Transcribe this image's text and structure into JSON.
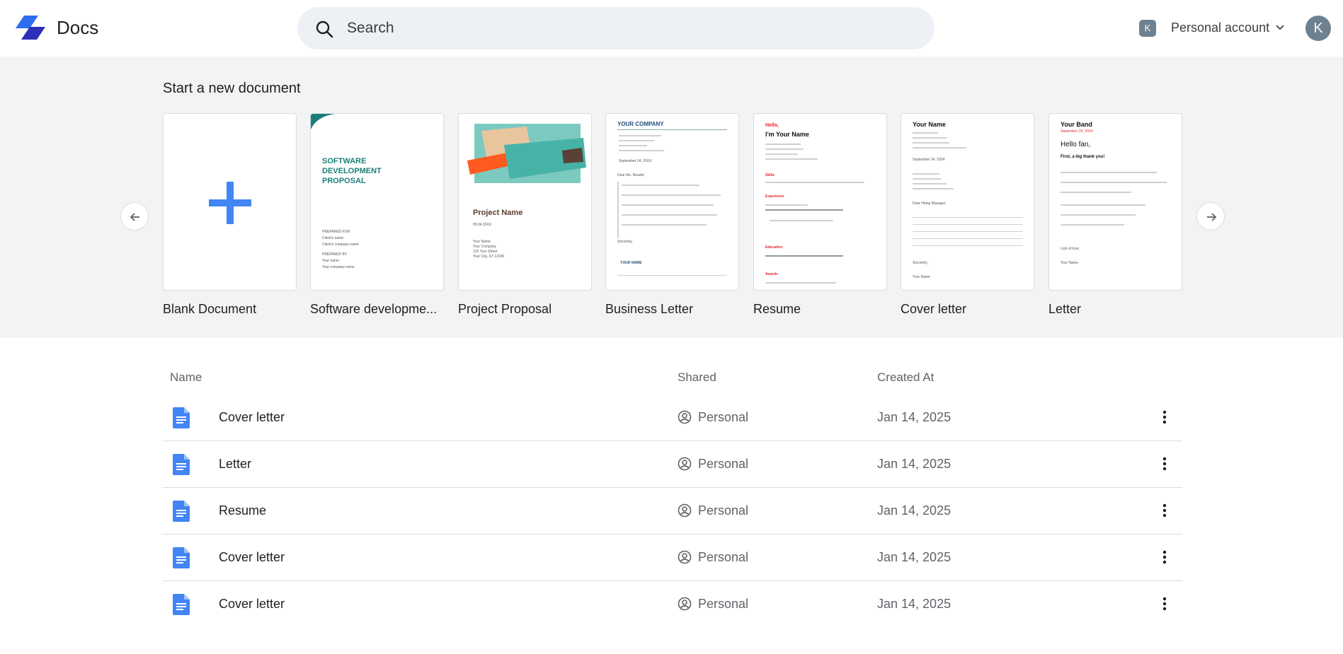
{
  "app": {
    "name": "Docs"
  },
  "search": {
    "placeholder": "Search"
  },
  "account": {
    "badge": "K",
    "label": "Personal account",
    "avatar": "K"
  },
  "templates": {
    "title": "Start a new document",
    "items": [
      {
        "label": "Blank Document"
      },
      {
        "label": "Software developme..."
      },
      {
        "label": "Project Proposal"
      },
      {
        "label": "Business Letter"
      },
      {
        "label": "Resume"
      },
      {
        "label": "Cover letter"
      },
      {
        "label": "Letter"
      }
    ],
    "previews": {
      "software": {
        "title": "SOFTWARE DEVELOPMENT PROPOSAL",
        "prepared_for": "PREPARED FOR",
        "client_name": "Client's name",
        "client_company": "Client's company name",
        "prepared_by": "PREPARED BY",
        "your_name": "Your name",
        "your_company": "Your company name"
      },
      "project": {
        "title": "Project Name",
        "date": "09.04.20XX",
        "lines": "Your Name\nYour Company\n123 Your Street\nYour City, ST 12345"
      },
      "business": {
        "company": "YOUR COMPANY",
        "sign": "YOUR NAME",
        "date": "September 24, 20XX",
        "greeting": "Dear Ms. Reader,",
        "closing": "Sincerely,"
      },
      "resume": {
        "hello": "Hello,",
        "name": "I'm Your Name",
        "skills": "Skills",
        "experience": "Experience",
        "education": "Education",
        "awards": "Awards"
      },
      "cover": {
        "name": "Your Name",
        "date": "September 24, 2024",
        "greeting": "Dear Hiring Manager,",
        "closing": "Sincerely,",
        "sign": "Your Name"
      },
      "letter": {
        "band": "Your Band",
        "date": "September 24, 20XX",
        "greeting": "Hello fan,",
        "lead": "First, a big thank you!",
        "closing": "Lots of love,",
        "sign": "Your Name"
      }
    }
  },
  "table": {
    "headers": {
      "name": "Name",
      "shared": "Shared",
      "created": "Created At"
    },
    "rows": [
      {
        "name": "Cover letter",
        "shared": "Personal",
        "created": "Jan 14, 2025"
      },
      {
        "name": "Letter",
        "shared": "Personal",
        "created": "Jan 14, 2025"
      },
      {
        "name": "Resume",
        "shared": "Personal",
        "created": "Jan 14, 2025"
      },
      {
        "name": "Cover letter",
        "shared": "Personal",
        "created": "Jan 14, 2025"
      },
      {
        "name": "Cover letter",
        "shared": "Personal",
        "created": "Jan 14, 2025"
      }
    ]
  },
  "colors": {
    "brand": "#2f5bea",
    "doc_icon": "#4285f4",
    "teal": "#1a7f7a",
    "resume_red": "#e8232a"
  }
}
